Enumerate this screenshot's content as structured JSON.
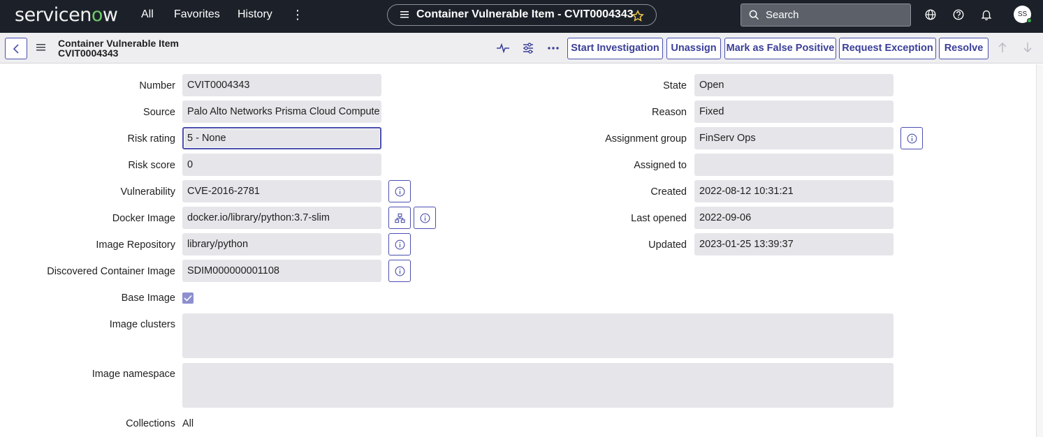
{
  "nav": {
    "logo_text": "servicenow",
    "links": [
      "All",
      "Favorites",
      "History"
    ],
    "record_title": "Container Vulnerable Item - CVIT0004343",
    "search_placeholder": "Search",
    "avatar_initials": "SS"
  },
  "header": {
    "title_line1": "Container Vulnerable Item",
    "title_line2": "CVIT0004343",
    "actions": [
      "Start Investigation",
      "Unassign",
      "Mark as False Positive",
      "Request Exception",
      "Resolve"
    ]
  },
  "form": {
    "left": [
      {
        "label": "Number",
        "value": "CVIT0004343"
      },
      {
        "label": "Source",
        "value": "Palo Alto Networks Prisma Cloud Compute"
      },
      {
        "label": "Risk rating",
        "value": "5 - None"
      },
      {
        "label": "Risk score",
        "value": "0"
      },
      {
        "label": "Vulnerability",
        "value": "CVE-2016-2781"
      },
      {
        "label": "Docker Image",
        "value": "docker.io/library/python:3.7-slim"
      },
      {
        "label": "Image Repository",
        "value": "library/python"
      },
      {
        "label": "Discovered Container Image",
        "value": "SDIM000000001108"
      }
    ],
    "right": [
      {
        "label": "State",
        "value": "Open"
      },
      {
        "label": "Reason",
        "value": "Fixed"
      },
      {
        "label": "Assignment group",
        "value": "FinServ Ops"
      },
      {
        "label": "Assigned to",
        "value": ""
      },
      {
        "label": "Created",
        "value": "2022-08-12 10:31:21"
      },
      {
        "label": "Last opened",
        "value": "2022-09-06"
      },
      {
        "label": "Updated",
        "value": "2023-01-25 13:39:37"
      }
    ],
    "base_image": {
      "label": "Base Image",
      "checked": true
    },
    "image_clusters": {
      "label": "Image clusters",
      "value": ""
    },
    "image_namespace": {
      "label": "Image namespace",
      "value": ""
    },
    "collections": {
      "label": "Collections",
      "value": "All"
    }
  },
  "colors": {
    "nav_bg": "#1c2129",
    "accent": "#4b4fae",
    "field_bg": "#e6e6ea"
  }
}
